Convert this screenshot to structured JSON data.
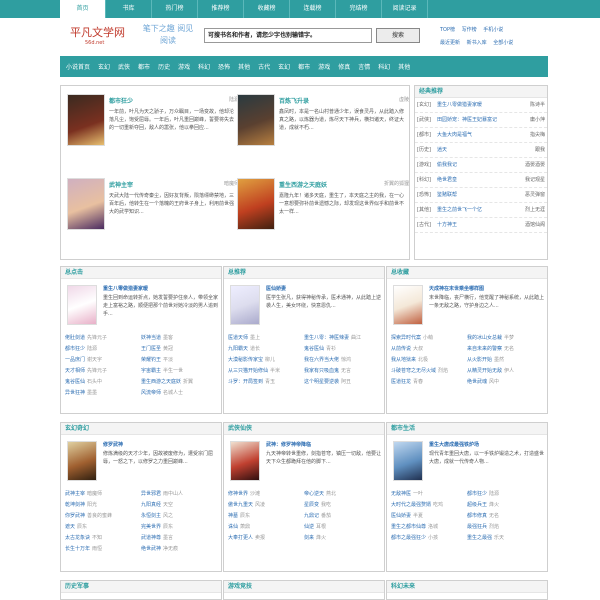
{
  "nav": [
    "首页",
    "书库",
    "热门榜",
    "推荐榜",
    "收藏榜",
    "连载榜",
    "完结榜",
    "阅读记录"
  ],
  "header": {
    "logo": "平凡文学网",
    "logo_sub": "56d.net",
    "slogan": "笔下之趣 阅见阅读",
    "search_placeholder": "可搜书名和作者，请您少字也别输错字。",
    "search_button": "搜索",
    "links": [
      "TOP榜",
      "写作榜",
      "手机小说",
      "最近更新",
      "新书入库",
      "全部小说"
    ]
  },
  "categories": [
    "小说首页",
    "玄幻",
    "武侠",
    "都市",
    "历史",
    "游戏",
    "科幻",
    "恐怖",
    "其他",
    "古代",
    "玄幻",
    "都市",
    "游戏",
    "修真",
    "言情",
    "科幻",
    "其他"
  ],
  "featured": [
    {
      "title": "都市狂少",
      "author": "陆源",
      "desc": "一年前，叶凡为天之骄子，万众瞩目，一场变故，他却沦落凡尘，饱受屈辱。一年后，叶凡重回巅峰，誓要将失去的一切重新夺回，敌人的嚣张，他以拳回应..."
    },
    {
      "title": "百炼飞升录",
      "author": "虚陵",
      "desc": "鑫凤时，本是一名山村普通少年，误食灵丹，从此踏入修真之路，以炼器为道，炼尽天下神兵，横扫诸天，终证大道，成就不朽..."
    },
    {
      "title": "武神主宰",
      "author": "暗魔师",
      "desc": "天武大陆一代传奇秦尘，因好友背叛，陨落缥缈禁地，三百年后，他转生在一个落魄的王府世子身上，利用前世强大的武学知识..."
    },
    {
      "title": "重生西游之天庭妖",
      "author": "折翼的狐狸",
      "desc": "嘉隆九年！诸多天庭，重生了，本天庭之主的我，在一心一意想要弥补前世遗憾之际，却发现这世界似乎和前世不太一样..."
    }
  ],
  "rank": {
    "title": "经典推荐",
    "rows": [
      {
        "g": "[玄幻]",
        "n": "重生八零做猎妻家暖",
        "a": "陈诗半"
      },
      {
        "g": "[武侠]",
        "n": "田园娇宠：神医王妃暴富记",
        "a": "庸小萍"
      },
      {
        "g": "[都市]",
        "n": "大鱼大肉是福气",
        "a": "指尖梅"
      },
      {
        "g": "[历史]",
        "n": "逍天",
        "a": "跟我"
      },
      {
        "g": "[游戏]",
        "n": "偷我我记",
        "a": "酒晏酒晏"
      },
      {
        "g": "[科幻]",
        "n": "绝世君皇",
        "a": "我记观星"
      },
      {
        "g": "[恐怖]",
        "n": "鉴赌联帮",
        "a": "恶灵弹窗"
      },
      {
        "g": "[其他]",
        "n": "重生之前世飞一个亿",
        "a": "烈上无涯"
      },
      {
        "g": "[古代]",
        "n": "十方神王",
        "a": "酒馆仙阁"
      }
    ]
  },
  "sections": [
    {
      "title": "总点击",
      "feature": {
        "title": "重生八零做猎妻家暖",
        "desc": "重生回到命运转折点，她发誓要护住亲人，带领全家走上富裕之路，顺便把那个前世对她冷淡的男人追到手..."
      },
      "lines": [
        {
          "name": "佬肚剑道",
          "author": "先锋元子"
        },
        {
          "name": "妖神当道",
          "author": "墨客"
        },
        {
          "name": "都市狂少",
          "author": "陆源"
        },
        {
          "name": "王门医圣",
          "author": "黄冠"
        },
        {
          "name": "一品庶门",
          "author": "谢天宇"
        },
        {
          "name": "荣耀钓王",
          "author": "平淡"
        },
        {
          "name": "天才相师",
          "author": "先锋元子"
        },
        {
          "name": "宇宙霸主",
          "author": "半生一世"
        },
        {
          "name": "鬼谷医仙",
          "author": "石头中"
        },
        {
          "name": "重生西游之天庭妖",
          "author": "折翼"
        },
        {
          "name": "异世狂神",
          "author": "墨墨"
        },
        {
          "name": "风流帝师",
          "author": "名城人士"
        }
      ]
    },
    {
      "title": "总推荐",
      "feature": {
        "title": "医仙娇妻",
        "desc": "医学生张凡，获得神秘传承，医术通神，从此踏上逆袭人生，美女环绕，快意恩仇..."
      },
      "lines": [
        {
          "name": "医道天师",
          "author": "墨上"
        },
        {
          "name": "重生八零：神医辣妻",
          "author": "曲江"
        },
        {
          "name": "九阳霸天",
          "author": "道长"
        },
        {
          "name": "鬼谷医仙",
          "author": "青衫"
        },
        {
          "name": "大漠秘影传家宝",
          "author": "柳儿"
        },
        {
          "name": "我在六界当大佬",
          "author": "惊鸿"
        },
        {
          "name": "从三只猫开始修仙",
          "author": "半米"
        },
        {
          "name": "我家有只吸血鬼",
          "author": "无言"
        },
        {
          "name": "斗罗：开局签到",
          "author": "青玉"
        },
        {
          "name": "这个明星要逆袭",
          "author": "阿丑"
        }
      ]
    },
    {
      "title": "总收藏",
      "feature": {
        "title": "天成神在末世乘坐哪样图",
        "desc": "末世降临，丧尸横行，他觉醒了神秘系统，从此踏上一条无敌之路，守护身边之人..."
      },
      "lines": [
        {
          "name": "探索异时代案",
          "author": "小萌"
        },
        {
          "name": "我的冰山女总裁",
          "author": "半梦"
        },
        {
          "name": "从前传说",
          "author": "大叔"
        },
        {
          "name": "来自未来的警察",
          "author": "无名"
        },
        {
          "name": "我从地狱来",
          "author": "北极"
        },
        {
          "name": "从火影开始",
          "author": "墨然"
        },
        {
          "name": "斗破苍穹之无尽火域",
          "author": "烈焰"
        },
        {
          "name": "从精灵开始无敌",
          "author": "伊人"
        },
        {
          "name": "医道狂龙",
          "author": "青春"
        },
        {
          "name": "绝世武魂",
          "author": "风中"
        }
      ]
    }
  ],
  "sections2": [
    {
      "title": "玄幻奇幻",
      "feature": {
        "title": "修罗武神",
        "desc": "修炼满级的天才少年，因故被废修为，遭受宗门屈辱，一怒之下，以修罗之力重回巅峰..."
      },
      "lines": [
        {
          "name": "武神主宰",
          "author": "暗魔师"
        },
        {
          "name": "异世邪君",
          "author": "雨中山人"
        },
        {
          "name": "乾坤剑神",
          "author": "阳光"
        },
        {
          "name": "九阳真经",
          "author": "天空"
        },
        {
          "name": "你罗武神",
          "author": "善良的蜜蜂"
        },
        {
          "name": "永恒剑主",
          "author": "风之"
        },
        {
          "name": "遮天",
          "author": "辰东"
        },
        {
          "name": "完美世界",
          "author": "辰东"
        },
        {
          "name": "太古龙象诀",
          "author": "不知"
        },
        {
          "name": "武道神尊",
          "author": "墨言"
        },
        {
          "name": "长生十万年",
          "author": "雨恒"
        },
        {
          "name": "绝世武神",
          "author": "净无痕"
        }
      ]
    },
    {
      "title": "武侠仙侠",
      "feature": {
        "title": "武神：修罗神帝降临",
        "desc": "九天神帝转世重修，剑指苍穹，镇压一切敌，他要让天下众生都跪拜在他的脚下..."
      },
      "lines": [
        {
          "name": "修神世界",
          "author": "沙滩"
        },
        {
          "name": "帝心逆天",
          "author": "燕北"
        },
        {
          "name": "傲世九重天",
          "author": "风凌"
        },
        {
          "name": "星辰变",
          "author": "我吃"
        },
        {
          "name": "神墓",
          "author": "辰东"
        },
        {
          "name": "九鼎记",
          "author": "番茄"
        },
        {
          "name": "诛仙",
          "author": "萧鼎"
        },
        {
          "name": "仙逆",
          "author": "耳根"
        },
        {
          "name": "大奉打更人",
          "author": "卖报"
        },
        {
          "name": "剑来",
          "author": "烽火"
        }
      ]
    },
    {
      "title": "都市生活",
      "feature": {
        "title": "重生大唐成最强铁炉场",
        "desc": "现代青年重回大唐，以一手铁炉锻造之术，打造盛世大唐，成就一代传奇人物..."
      },
      "lines": [
        {
          "name": "无敌神医",
          "author": "一叶"
        },
        {
          "name": "都市狂少",
          "author": "陆源"
        },
        {
          "name": "大时代之最强赘婿",
          "author": "吃鸡"
        },
        {
          "name": "超级兵王",
          "author": "烽火"
        },
        {
          "name": "医仙娇妻",
          "author": "半夏"
        },
        {
          "name": "都市修真",
          "author": "无名"
        },
        {
          "name": "重生之都市仙尊",
          "author": "洛城"
        },
        {
          "name": "最强狂兵",
          "author": "烈焰"
        },
        {
          "name": "都市之最强狂少",
          "author": "小孩"
        },
        {
          "name": "重生之最强",
          "author": "乐天"
        }
      ]
    }
  ],
  "bottom_titles": [
    "历史军事",
    "游戏竞技",
    "科幻未来"
  ]
}
